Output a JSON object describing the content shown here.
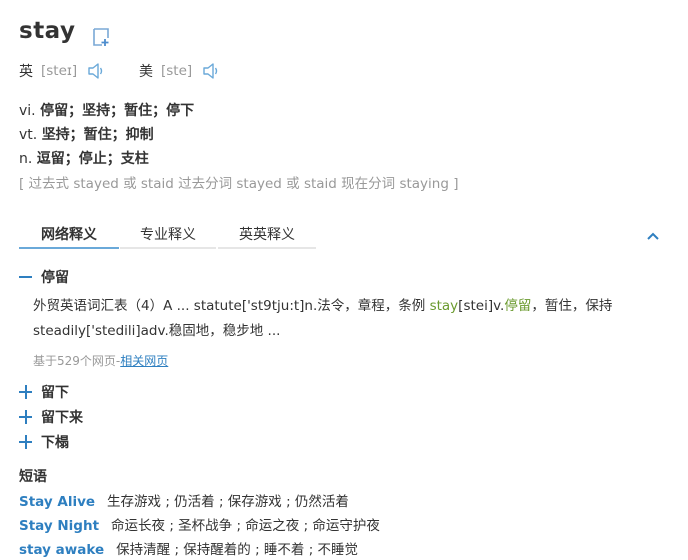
{
  "headword": "stay",
  "pronunciations": [
    {
      "label": "英",
      "phonetic": "[steɪ]"
    },
    {
      "label": "美",
      "phonetic": "[ste]"
    }
  ],
  "definitions": [
    {
      "pos": "vi.",
      "text": "停留；坚持；暂住；停下"
    },
    {
      "pos": "vt.",
      "text": "坚持；暂住；抑制"
    },
    {
      "pos": "n.",
      "text": "逗留；停止；支柱"
    }
  ],
  "word_forms": "[ 过去式 stayed 或 staid 过去分词 stayed 或 staid 现在分词 staying ]",
  "tabs": [
    "网络释义",
    "专业释义",
    "英英释义"
  ],
  "active_tab": "网络释义",
  "web_senses": [
    {
      "title": "停留",
      "expanded": true
    },
    {
      "title": "留下",
      "expanded": false
    },
    {
      "title": "留下来",
      "expanded": false
    },
    {
      "title": "下榻",
      "expanded": false
    }
  ],
  "example": {
    "part1": "外贸英语词汇表（4）A ... statute['st9tju:t]n.法令，章程，条例 ",
    "hl1": "stay",
    "part2": "[stei]v.",
    "hl2": "停留",
    "part3": "，暂住，保持",
    "line2": "steadily['stedili]adv.稳固地，稳步地 ..."
  },
  "source": {
    "prefix": "基于529个网页-",
    "link": "相关网页"
  },
  "phrases_title": "短语",
  "phrases": [
    {
      "en": "Stay Alive",
      "cn": "生存游戏 ; 仍活着 ; 保存游戏 ; 仍然活着"
    },
    {
      "en": "Stay Night",
      "cn": "命运长夜 ; 圣杯战争 ; 命运之夜 ; 命运守护夜"
    },
    {
      "en": "stay awake",
      "cn": "保持清醒 ; 保持醒着的 ; 睡不着 ; 不睡觉"
    }
  ],
  "colors": {
    "link": "#2e7fc0",
    "highlight": "#6a9a2e",
    "tab_active": "#6aa9d9",
    "muted": "#999999"
  },
  "icons": [
    "add-to-wordbook-icon",
    "speaker-icon",
    "chevron-up-icon",
    "minus-icon",
    "plus-icon"
  ]
}
